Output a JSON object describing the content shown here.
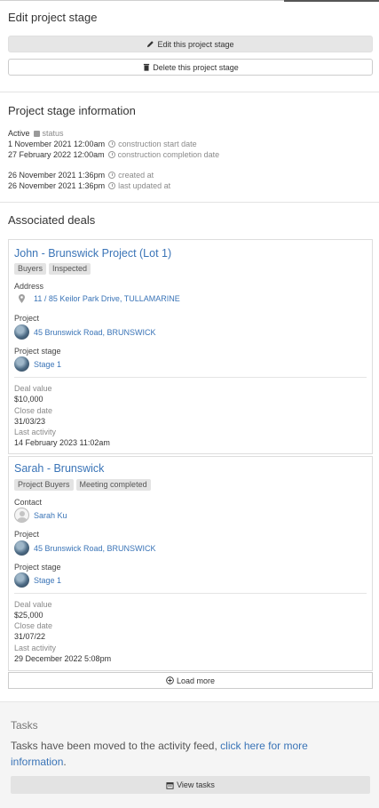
{
  "edit_section": {
    "title": "Edit project stage",
    "edit_button": "Edit this project stage",
    "delete_button": "Delete this project stage"
  },
  "info_section": {
    "title": "Project stage information",
    "status_value": "Active",
    "status_label": "status",
    "start_value": "1 November 2021 12:00am",
    "start_label": "construction start date",
    "completion_value": "27 February 2022 12:00am",
    "completion_label": "construction completion date",
    "created_value": "26 November 2021 1:36pm",
    "created_label": "created at",
    "updated_value": "26 November 2021 1:36pm",
    "updated_label": "last updated at"
  },
  "deals_section": {
    "title": "Associated deals",
    "deals": [
      {
        "title": "John - Brunswick Project (Lot 1)",
        "tags": [
          "Buyers",
          "Inspected"
        ],
        "address_label": "Address",
        "address_value": "11 / 85 Keilor Park Drive, TULLAMARINE",
        "project_label": "Project",
        "project_value": "45 Brunswick Road, BRUNSWICK",
        "stage_label": "Project stage",
        "stage_value": "Stage 1",
        "deal_value_label": "Deal value",
        "deal_value": "$10,000",
        "close_date_label": "Close date",
        "close_date": "31/03/23",
        "last_activity_label": "Last activity",
        "last_activity": "14 February 2023 11:02am"
      },
      {
        "title": "Sarah - Brunswick",
        "tags": [
          "Project Buyers",
          "Meeting completed"
        ],
        "contact_label": "Contact",
        "contact_value": "Sarah Ku",
        "project_label": "Project",
        "project_value": "45 Brunswick Road, BRUNSWICK",
        "stage_label": "Project stage",
        "stage_value": "Stage 1",
        "deal_value_label": "Deal value",
        "deal_value": "$25,000",
        "close_date_label": "Close date",
        "close_date": "31/07/22",
        "last_activity_label": "Last activity",
        "last_activity": "29 December 2022 5:08pm"
      }
    ],
    "load_more": "Load more"
  },
  "tasks_section": {
    "title": "Tasks",
    "text": "Tasks have been moved to the activity feed,",
    "link": "click here for more information",
    "text_end": ".",
    "button": "View tasks"
  },
  "icons": [
    "pencil-icon",
    "trash-icon",
    "status-icon",
    "clock-icon",
    "map-pin-icon",
    "plus-circle-icon",
    "calendar-icon"
  ],
  "colors": {
    "link": "#3a74b7",
    "muted": "#8a8a8a",
    "button_grey": "#e6e6e6",
    "tasks_bg": "#f5f5f5"
  }
}
